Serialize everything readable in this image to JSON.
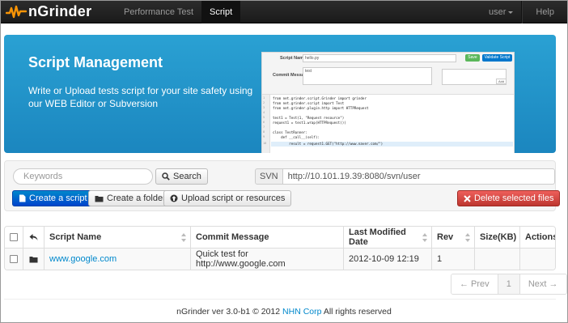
{
  "navbar": {
    "brand": "nGrinder",
    "items": [
      {
        "label": "Performance Test",
        "active": false
      },
      {
        "label": "Script",
        "active": true
      }
    ],
    "user": "user",
    "help": "Help"
  },
  "banner": {
    "title": "Script Management",
    "description": "Write or Upload tests script for your site safety using our WEB Editor or Subversion",
    "mock": {
      "script_name_label": "Script Name",
      "script_name_value": "hello.py",
      "commit_label": "Commit Message",
      "commit_value": "test",
      "save_button": "Save",
      "validate_button": "Validate Script",
      "add_button": "Add",
      "code_lines": [
        "from net.grinder.script.Grinder import grinder",
        "from net.grinder.script import Test",
        "from net.grinder.plugin.http import HTTPRequest",
        "",
        "test1 = Test(1, \"Request resource\")",
        "request1 = test1.wrap(HTTPRequest())",
        "",
        "class TestRunner:",
        "    def __call__(self):",
        "        result = request1.GET(\"http://www.naver.com/\")"
      ]
    }
  },
  "toolbar": {
    "search_placeholder": "Keywords",
    "search_button": "Search",
    "svn_label": "SVN",
    "svn_url": "http://10.101.19.39:8080/svn/user",
    "create_script": "Create a script",
    "create_folder": "Create a folder",
    "upload": "Upload script or resources",
    "delete": "Delete selected files"
  },
  "table": {
    "headers": [
      "",
      "",
      "Script Name",
      "Commit Message",
      "Last Modified Date",
      "Rev",
      "Size(KB)",
      "Actions"
    ],
    "rows": [
      {
        "name": "www.google.com",
        "message": "Quick test for http://www.google.com",
        "date": "2012-10-09 12:19",
        "rev": "1",
        "size": "",
        "actions": ""
      }
    ]
  },
  "pagination": {
    "prev": "← Prev",
    "page": "1",
    "next": "Next →"
  },
  "footer": {
    "prefix": "nGrinder ver 3.0-b1 © 2012",
    "company": "NHN Corp",
    "suffix": "All rights reserved"
  },
  "colors": {
    "navbar": "#1f1f1f",
    "banner": "#1f94cc",
    "brand_orange": "#f89406",
    "primary": "#0062cc",
    "danger": "#d9412c",
    "link": "#0088cc"
  }
}
